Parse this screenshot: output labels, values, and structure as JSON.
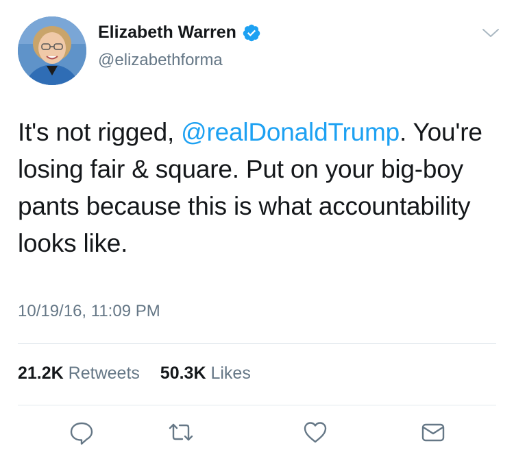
{
  "author": {
    "name": "Elizabeth Warren",
    "handle": "@elizabethforma",
    "verified": true
  },
  "tweet": {
    "text_line1_pre": "It's not rigged, ",
    "mention": "@realDonaldTrump",
    "text_line1_post": ".",
    "text_rest": "You're losing fair & square. Put on your big-boy pants because this is what accountability looks like.",
    "timestamp": "10/19/16, 11:09 PM"
  },
  "stats": {
    "retweets_count": "21.2K",
    "retweets_label": "Retweets",
    "likes_count": "50.3K",
    "likes_label": "Likes"
  },
  "actions": [
    "reply-icon",
    "retweet-icon",
    "like-icon",
    "message-icon"
  ],
  "colors": {
    "link": "#1da1f2",
    "secondary_text": "#657786",
    "divider": "#e1e8ed",
    "verified": "#1da1f2"
  }
}
